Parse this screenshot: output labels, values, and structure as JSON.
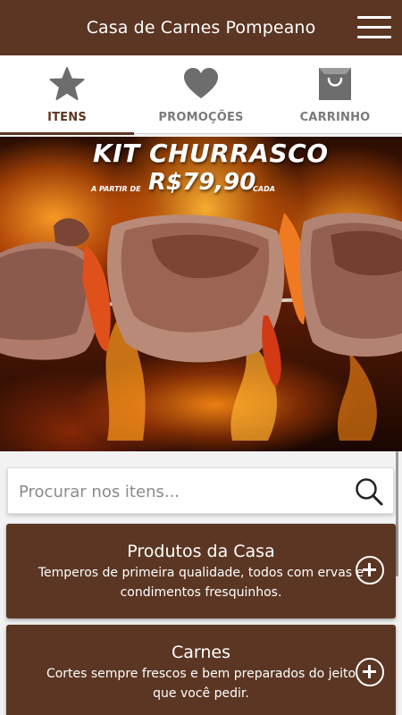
{
  "header": {
    "title": "Casa de Carnes Pompeano",
    "menu_icon": "hamburger-menu-icon"
  },
  "tabs": [
    {
      "label": "ITENS",
      "icon": "star-icon",
      "active": true
    },
    {
      "label": "PROMOÇÕES",
      "icon": "heart-icon",
      "active": false
    },
    {
      "label": "CARRINHO",
      "icon": "shopping-bag-icon",
      "active": false
    }
  ],
  "banner": {
    "headline": "KIT CHURRASCO",
    "price_prefix": "A PARTIR DE",
    "price": "R$79,90",
    "price_suffix": "CADA"
  },
  "search": {
    "placeholder": "Procurar nos itens...",
    "value": ""
  },
  "categories": [
    {
      "title": "Produtos da Casa",
      "description": "Temperos de primeira qualidade, todos com ervas e condimentos fresquinhos."
    },
    {
      "title": "Carnes",
      "description": "Cortes sempre frescos e bem preparados do jeito que você pedir."
    }
  ],
  "colors": {
    "brand": "#5b3623",
    "tab_inactive": "#7a7a7a",
    "background": "#f2f2f2"
  }
}
